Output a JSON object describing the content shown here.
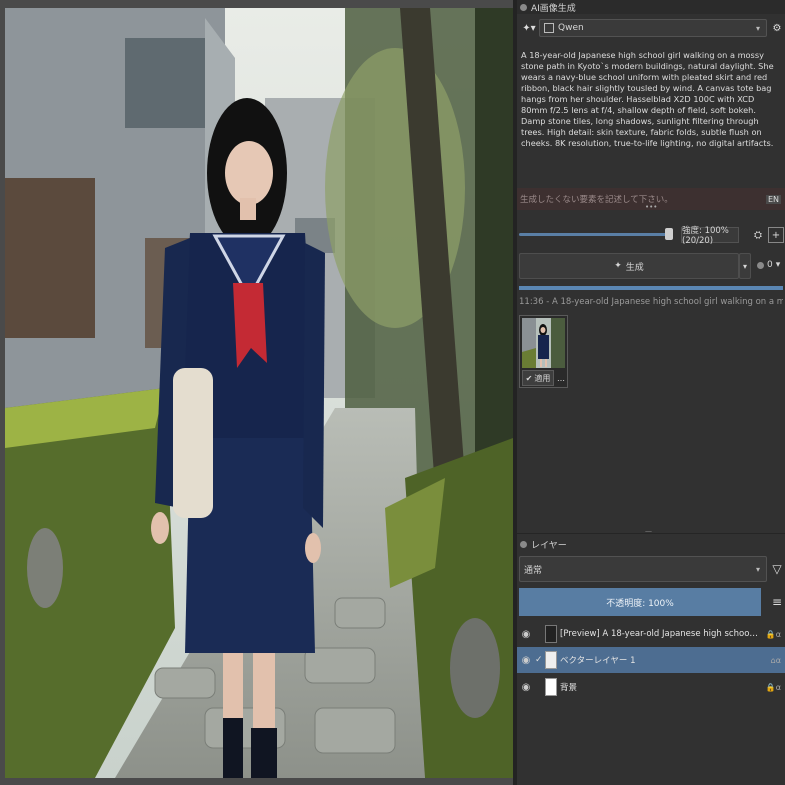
{
  "ai_panel": {
    "title": "AI画像生成",
    "model": "Qwen",
    "prompt": "A 18-year-old Japanese high school girl walking on a mossy stone path in Kyoto`s modern buildings, natural daylight. She wears a navy-blue school uniform with pleated skirt and red ribbon, black hair slightly tousled by wind. A canvas tote bag hangs from her shoulder. Hasselblad X2D 100C with XCD 80mm f/2.5 lens at f/4, shallow depth of field, soft bokeh. Damp stone tiles, long shadows, sunlight filtering through trees. High detail: skin texture, fabric folds, subtle flush on cheeks. 8K resolution, true-to-life lighting, no digital artifacts.",
    "negative_placeholder": "生成したくない要素を記述して下さい。",
    "lang": "EN",
    "strength_label": "強度: 100% (20/20)",
    "generate_label": "生成",
    "seed_count": "0",
    "history_text": "11:36 - A 18-year-old Japanese high school girl walking on a mossy stone path in Kyoto`s",
    "apply_label": "適用",
    "more": "…"
  },
  "layers_panel": {
    "title": "レイヤー",
    "blend_mode": "通常",
    "opacity_label": "不透明度: 100%",
    "layers": [
      {
        "name": "[Preview] A 18-year-old Japanese high school girl walking on a mo…",
        "active": false
      },
      {
        "name": "ベクターレイヤー 1",
        "active": true
      },
      {
        "name": "背景",
        "active": false
      }
    ]
  },
  "colors": {
    "accent": "#587da3",
    "active_layer": "#4d6d91"
  },
  "icons": [
    "gear-icon",
    "eye-icon",
    "filter-icon",
    "menu-icon",
    "lock-icon",
    "alpha-icon",
    "wand-icon",
    "dice-icon"
  ]
}
